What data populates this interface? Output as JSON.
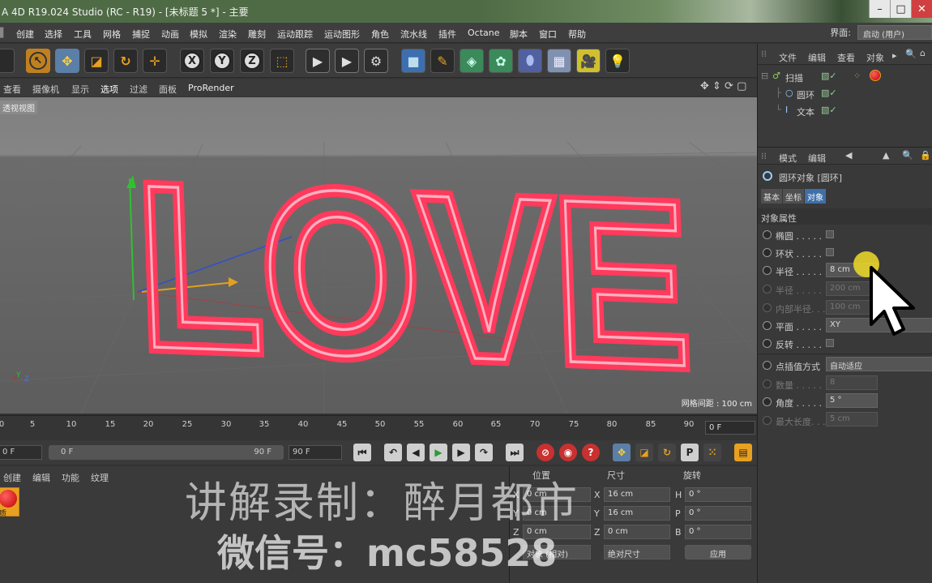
{
  "window": {
    "title": "A 4D R19.024 Studio (RC - R19) - [未标题 5 *] - 主要"
  },
  "menu": [
    "创建",
    "选择",
    "工具",
    "网格",
    "捕捉",
    "动画",
    "模拟",
    "渲染",
    "雕刻",
    "运动跟踪",
    "运动图形",
    "角色",
    "流水线",
    "插件",
    "Octane",
    "脚本",
    "窗口",
    "帮助"
  ],
  "interface": {
    "label": "界面:",
    "value": "启动 (用户)"
  },
  "toolbar": {
    "x": "X",
    "y": "Y",
    "z": "Z"
  },
  "viewport_menu": [
    "查看",
    "摄像机",
    "显示",
    "选项",
    "过滤",
    "面板",
    "ProRender"
  ],
  "viewport": {
    "name": "透视视图",
    "grid_label": "网格间距 : 100 cm",
    "text3d": "LOVE"
  },
  "timeline": {
    "ticks": [
      "0",
      "5",
      "10",
      "15",
      "20",
      "25",
      "30",
      "35",
      "40",
      "45",
      "50",
      "55",
      "60",
      "65",
      "70",
      "75",
      "80",
      "85",
      "90"
    ],
    "current": "0 F"
  },
  "transport": {
    "start": "0 F",
    "range_start": "0 F",
    "range_end": "90 F",
    "end": "90 F"
  },
  "material_panel": {
    "tabs": [
      "创建",
      "编辑",
      "功能",
      "纹理"
    ],
    "material_label": "质"
  },
  "coordinates": {
    "headers": [
      "位置",
      "尺寸",
      "旋转"
    ],
    "pos": [
      "0 cm",
      "0 cm",
      "0 cm"
    ],
    "size": [
      "16 cm",
      "16 cm",
      "0 cm"
    ],
    "rot": [
      "0 °",
      "0 °",
      "0 °"
    ],
    "axes_pos": [
      "X",
      "Y",
      "Z"
    ],
    "axes_rot": [
      "H",
      "P",
      "B"
    ],
    "mode1": "对象 (相对)",
    "mode2": "绝对尺寸",
    "apply": "应用"
  },
  "objects_panel": {
    "menu": [
      "文件",
      "编辑",
      "查看",
      "对象"
    ],
    "items": [
      {
        "name": "扫描",
        "color": "#e0a040"
      },
      {
        "name": "圆环",
        "color": "#e0a040"
      },
      {
        "name": "文本",
        "color": "#cfcfcf"
      }
    ]
  },
  "attributes_panel": {
    "menu": [
      "模式",
      "编辑"
    ],
    "object_title": "圆环对象 [圆环]",
    "tabs": [
      "基本",
      "坐标",
      "对象"
    ],
    "section": "对象属性",
    "props": [
      {
        "label": "椭圆 . . . . .",
        "type": "check"
      },
      {
        "label": "环状 . . . . .",
        "type": "check"
      },
      {
        "label": "半径 . . . . .",
        "value": "8 cm"
      },
      {
        "label": "半径 . . . . .",
        "value": "200 cm",
        "dim": true
      },
      {
        "label": "内部半径. . .",
        "value": "100 cm",
        "dim": true
      },
      {
        "label": "平面 . . . . .",
        "value": "XY"
      },
      {
        "label": "反转 . . . . .",
        "type": "check"
      },
      {
        "label": "点插值方式",
        "value": "自动适应"
      },
      {
        "label": "数量 . . . . .",
        "value": "8",
        "dim": true
      },
      {
        "label": "角度 . . . . .",
        "value": "5 °"
      },
      {
        "label": "最大长度. . .",
        "value": "5 cm",
        "dim": true
      }
    ]
  },
  "watermark": {
    "line1": "讲解录制：醉月都市",
    "line2": "微信号：mc58528"
  }
}
